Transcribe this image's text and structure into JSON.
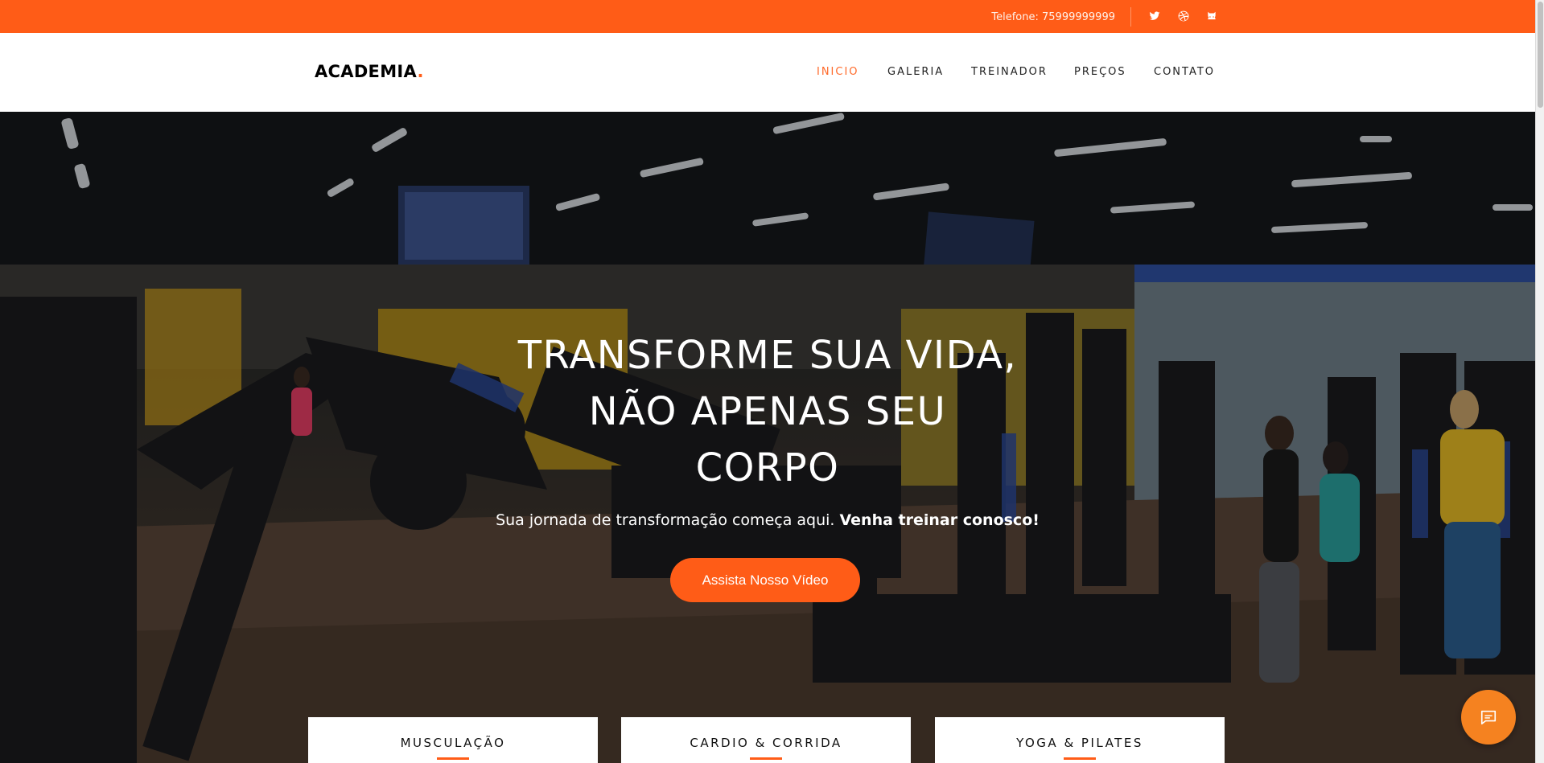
{
  "topbar": {
    "phone": "Telefone: 75999999999",
    "social_icons": [
      "twitter-icon",
      "dribbble-icon",
      "github-icon"
    ]
  },
  "header": {
    "logo_text": "ACADEMIA",
    "logo_dot": ".",
    "nav": [
      {
        "label": "INICIO",
        "active": true
      },
      {
        "label": "GALERIA",
        "active": false
      },
      {
        "label": "TREINADOR",
        "active": false
      },
      {
        "label": "PREÇOS",
        "active": false
      },
      {
        "label": "CONTATO",
        "active": false
      }
    ]
  },
  "hero": {
    "title_line1": "TRANSFORME SUA VIDA,",
    "title_line2": "NÃO APENAS SEU",
    "title_line3": "CORPO",
    "subtitle": "Sua jornada de transformação começa aqui.",
    "subtitle_bold": "Venha treinar conosco!",
    "cta_label": "Assista Nosso Vídeo"
  },
  "services": [
    {
      "label": "MUSCULAÇÃO"
    },
    {
      "label": "CARDIO & CORRIDA"
    },
    {
      "label": "YOGA & PILATES"
    }
  ],
  "chat": {
    "icon": "chat-icon"
  },
  "colors": {
    "accent": "#ff5c17",
    "chat": "#f58220"
  }
}
